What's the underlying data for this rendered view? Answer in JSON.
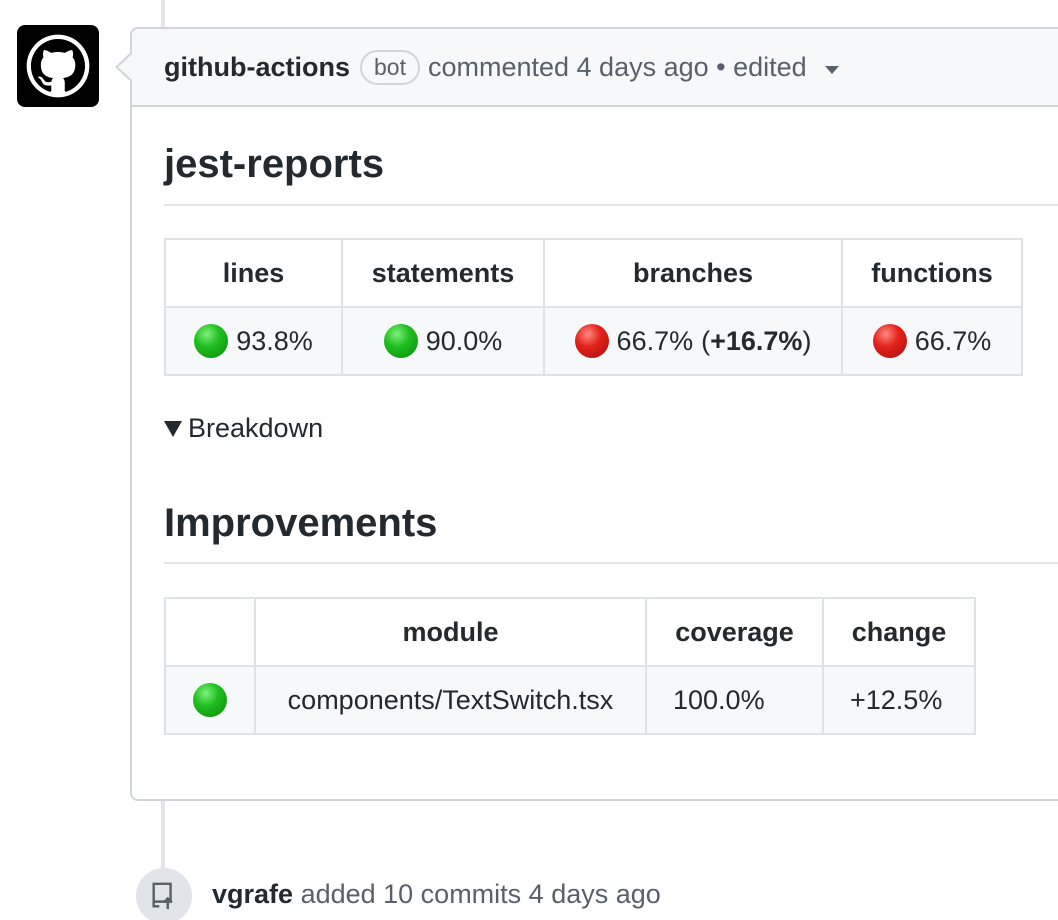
{
  "comment": {
    "author": "github-actions",
    "badge": "bot",
    "meta": "commented 4 days ago • edited",
    "avatar_icon": "github-octocat-icon"
  },
  "report": {
    "title": "jest-reports",
    "headers": [
      "lines",
      "statements",
      "branches",
      "functions"
    ],
    "cells": [
      {
        "status": "green",
        "value": "93.8%",
        "delta": ""
      },
      {
        "status": "green",
        "value": "90.0%",
        "delta": ""
      },
      {
        "status": "red",
        "value": "66.7%",
        "delta": "+16.7%"
      },
      {
        "status": "red",
        "value": "66.7%",
        "delta": ""
      }
    ]
  },
  "breakdown": {
    "label": "Breakdown"
  },
  "improvements": {
    "title": "Improvements",
    "headers": [
      "",
      "module",
      "coverage",
      "change"
    ],
    "rows": [
      {
        "status": "green",
        "module": "components/TextSwitch.tsx",
        "coverage": "100.0%",
        "change": "+12.5%"
      }
    ]
  },
  "event": {
    "user": "vgrafe",
    "text": "added 10 commits 4 days ago",
    "icon": "repo-push-icon"
  },
  "colors": {
    "green": "#1fbe1f",
    "red": "#e3221c",
    "border": "#d1d5da",
    "header_bg": "#f6f8fa"
  }
}
